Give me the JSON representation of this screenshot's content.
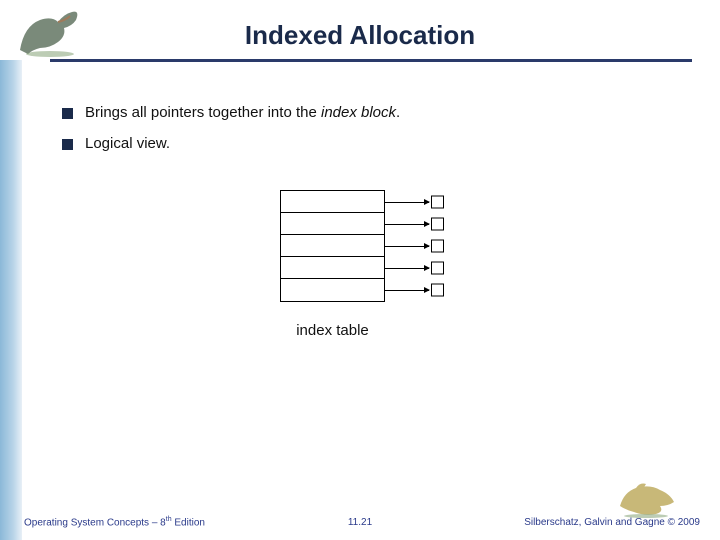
{
  "title": "Indexed Allocation",
  "bullets": [
    {
      "pre": "Brings all pointers together into the ",
      "em": "index block",
      "post": "."
    },
    {
      "pre": "Logical view.",
      "em": "",
      "post": ""
    }
  ],
  "diagram": {
    "label": "index table",
    "row_count": 5
  },
  "footer": {
    "left_pre": "Operating System Concepts – 8",
    "left_sup": "th",
    "left_post": " Edition",
    "center": "11.21",
    "right": "Silberschatz, Galvin and Gagne © 2009"
  }
}
